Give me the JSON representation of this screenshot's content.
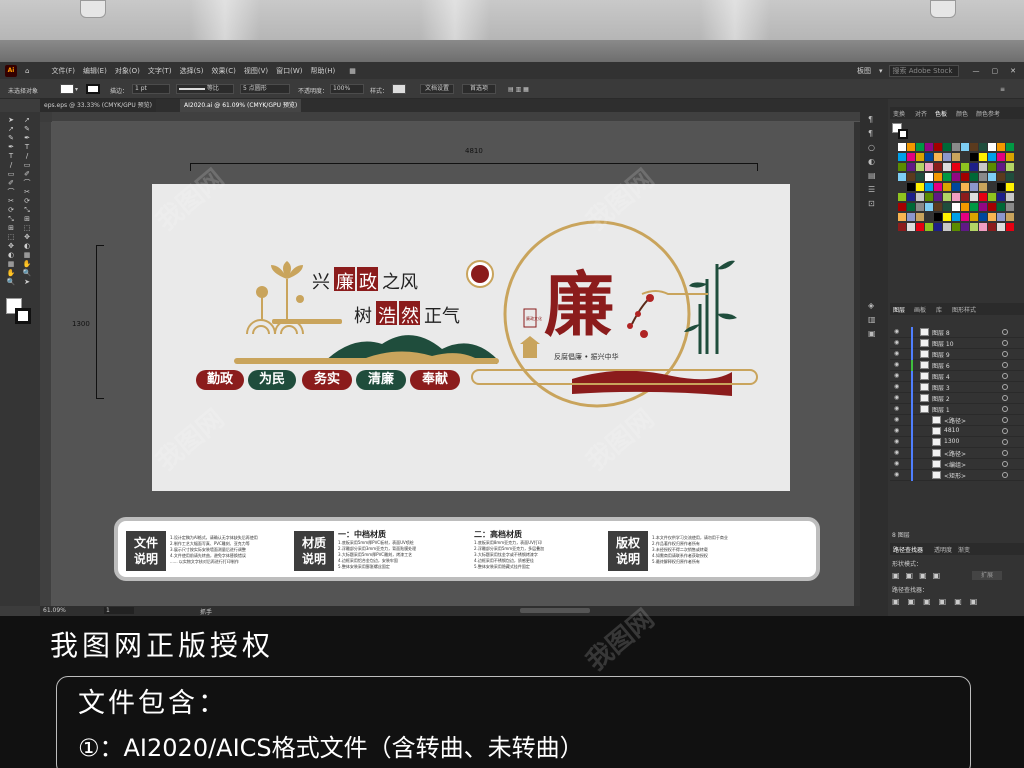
{
  "menubar": {
    "items": [
      "文件(F)",
      "编辑(E)",
      "对象(O)",
      "文字(T)",
      "选择(S)",
      "效果(C)",
      "视图(V)",
      "窗口(W)",
      "帮助(H)"
    ],
    "workspace": "板图",
    "search_placeholder": "搜索 Adobe Stock"
  },
  "control_bar": {
    "selection_label": "未选择对象",
    "stroke_label": "描边：",
    "stroke_value": "1 pt",
    "profile_value": "等比",
    "brush_value": "5 点圆形",
    "opacity_label": "不透明度：",
    "opacity_value": "100%",
    "style_label": "样式：",
    "doc_setup_button": "文档设置",
    "preferences_button": "首选项"
  },
  "tabs": [
    {
      "label": "eps.eps @ 33.33% (CMYK/GPU 预览)",
      "active": false
    },
    {
      "label": "AI2020.ai @ 61.09% (CMYK/GPU 预览)",
      "active": true
    }
  ],
  "status": {
    "zoom": "61.09%",
    "page": "1",
    "tool": "抓手"
  },
  "dimensions": {
    "width_label": "4810",
    "height_label": "1300"
  },
  "artwork": {
    "headline_1": [
      "兴",
      "廉",
      "政",
      "之风"
    ],
    "headline_2": [
      "树",
      "浩",
      "然",
      "正气"
    ],
    "big_char": "廉",
    "seal": "廉政文化",
    "caption": "反腐倡廉 • 振兴中华",
    "pills": [
      "勤政",
      "为民",
      "务实",
      "清廉",
      "奉献"
    ],
    "colors": {
      "red": "#8b1c1c",
      "green": "#1f4d3c",
      "gold": "#c9a45c"
    }
  },
  "info_panel": {
    "tag1": [
      "文件",
      "说明"
    ],
    "tag2": [
      "材质",
      "说明"
    ],
    "tag3": [
      "版权",
      "说明"
    ],
    "col1_lines": [
      "1.设计定稿为AI格式，请确认无字体缺失后再使用",
      "2.制作工艺大幅面写真、PVC雕刻、亚克力等",
      "3.展示尺寸按实际安装墙面测量后进行调整",
      "4.文件使用前请先转曲，避免字体替换错误",
      "...... 以实物文字核对后再进行打印制作"
    ],
    "col2_title": "一：中档材质",
    "col2_lines": [
      "1.底板采用5mm厚PVC板材，表面UV喷绘",
      "2.浮雕部分采用3mm亚克力，背面贴膜处理",
      "3.大标题采用5mm厚PVC雕刻，烤漆工艺",
      "4.边框采用铝合金包边，安装牢固",
      "5.整体安装采用膨胀螺丝固定"
    ],
    "col3_title": "二：高档材质",
    "col3_lines": [
      "1.底板采用8mm亚克力，表面UV打印",
      "2.浮雕部分采用5mm亚克力，多层叠加",
      "3.大标题采用钛金字或不锈钢烤漆字",
      "4.边框采用不锈钢包边，质感更佳",
      "5.整体安装采用隐藏式挂件固定"
    ],
    "col4_lines": [
      "1.本文件仅供学习交流使用，请勿用于商业",
      "2.作品著作权归原作者所有",
      "3.未经授权不得二次销售或转载",
      "4.如需商用请联系作者获取授权",
      "5.最终解释权归原作者所有"
    ]
  },
  "layers": {
    "tabs": [
      "图层",
      "画板",
      "库",
      "图形样式"
    ],
    "rows": [
      {
        "name": "图层 8",
        "color": "#4f7fff"
      },
      {
        "name": "图层 10",
        "color": "#4f7fff"
      },
      {
        "name": "图层 9",
        "color": "#4f7fff"
      },
      {
        "name": "图层 6",
        "color": "#3fbf3f"
      },
      {
        "name": "图层 4",
        "color": "#4f7fff"
      },
      {
        "name": "图层 3",
        "color": "#4f7fff"
      },
      {
        "name": "图层 2",
        "color": "#4f7fff"
      },
      {
        "name": "图层 1",
        "color": "#4f7fff"
      },
      {
        "name": "<路径>",
        "color": "#4f7fff"
      },
      {
        "name": "4810",
        "color": "#4f7fff"
      },
      {
        "name": "1300",
        "color": "#4f7fff"
      },
      {
        "name": "<路径>",
        "color": "#4f7fff"
      },
      {
        "name": "<编组>",
        "color": "#4f7fff"
      },
      {
        "name": "<矩形>",
        "color": "#4f7fff"
      }
    ],
    "count": "8 图层"
  },
  "swatch_tabs": [
    "变换",
    "对齐",
    "色板",
    "颜色",
    "颜色参考"
  ],
  "pathfinder": {
    "tabs": [
      "路径查找器",
      "透明度",
      "渐变"
    ],
    "shape_modes_label": "形状模式：",
    "expand_button": "扩展",
    "pathfinder_label": "路径查找器："
  },
  "banner": {
    "title": "我图网正版授权"
  },
  "bottom": {
    "title": "文件包含：",
    "line1": "①：AI2020/AICS格式文件（含转曲、未转曲）"
  },
  "watermark": "我图网"
}
